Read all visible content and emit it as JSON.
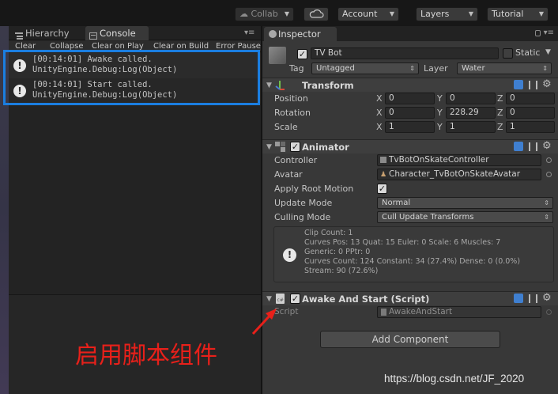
{
  "toolbar": {
    "collab_label": "Collab",
    "account_label": "Account",
    "layers_label": "Layers",
    "layout_label": "Tutorial"
  },
  "left_panel": {
    "tabs": [
      {
        "label": "Hierarchy",
        "icon": "list-icon"
      },
      {
        "label": "Console",
        "icon": "console-icon"
      }
    ],
    "console_toolbar": [
      "Clear",
      "Collapse",
      "Clear on Play",
      "Clear on Build",
      "Error Pause"
    ],
    "logs": [
      {
        "line1": "[00:14:01] Awake called.",
        "line2": "UnityEngine.Debug:Log(Object)",
        "icon": "info-icon"
      },
      {
        "line1": "[00:14:01] Start called.",
        "line2": "UnityEngine.Debug:Log(Object)",
        "icon": "info-icon"
      }
    ]
  },
  "inspector": {
    "tab_label": "Inspector",
    "object": {
      "active": true,
      "name": "TV Bot",
      "static_label": "Static",
      "tag_label": "Tag",
      "tag_value": "Untagged",
      "layer_label": "Layer",
      "layer_value": "Water"
    },
    "transform": {
      "title": "Transform",
      "rows": [
        {
          "label": "Position",
          "x": "0",
          "y": "0",
          "z": "0"
        },
        {
          "label": "Rotation",
          "x": "0",
          "y": "228.29",
          "z": "0"
        },
        {
          "label": "Scale",
          "x": "1",
          "y": "1",
          "z": "1"
        }
      ],
      "axes": [
        "X",
        "Y",
        "Z"
      ]
    },
    "animator": {
      "title": "Animator",
      "enabled": true,
      "controller_label": "Controller",
      "controller_value": "TvBotOnSkateController",
      "avatar_label": "Avatar",
      "avatar_value": "Character_TvBotOnSkateAvatar",
      "apply_root_motion_label": "Apply Root Motion",
      "apply_root_motion": true,
      "update_mode_label": "Update Mode",
      "update_mode_value": "Normal",
      "culling_mode_label": "Culling Mode",
      "culling_mode_value": "Cull Update Transforms",
      "info": [
        "Clip Count: 1",
        "Curves Pos: 13 Quat: 15 Euler: 0 Scale: 6 Muscles: 7",
        "Generic: 0 PPtr: 0",
        "Curves Count: 124 Constant: 34 (27.4%) Dense: 0 (0.0%)",
        "Stream: 90 (72.6%)"
      ]
    },
    "script_component": {
      "title": "Awake And Start (Script)",
      "enabled": true,
      "script_label": "Script",
      "script_value": "AwakeAndStart"
    },
    "add_component_label": "Add Component"
  },
  "annotation": {
    "text": "启用脚本组件",
    "color": "#e8201a"
  },
  "highlight_color": "#1b7ee0",
  "watermark": "https://blog.csdn.net/JF_2020"
}
